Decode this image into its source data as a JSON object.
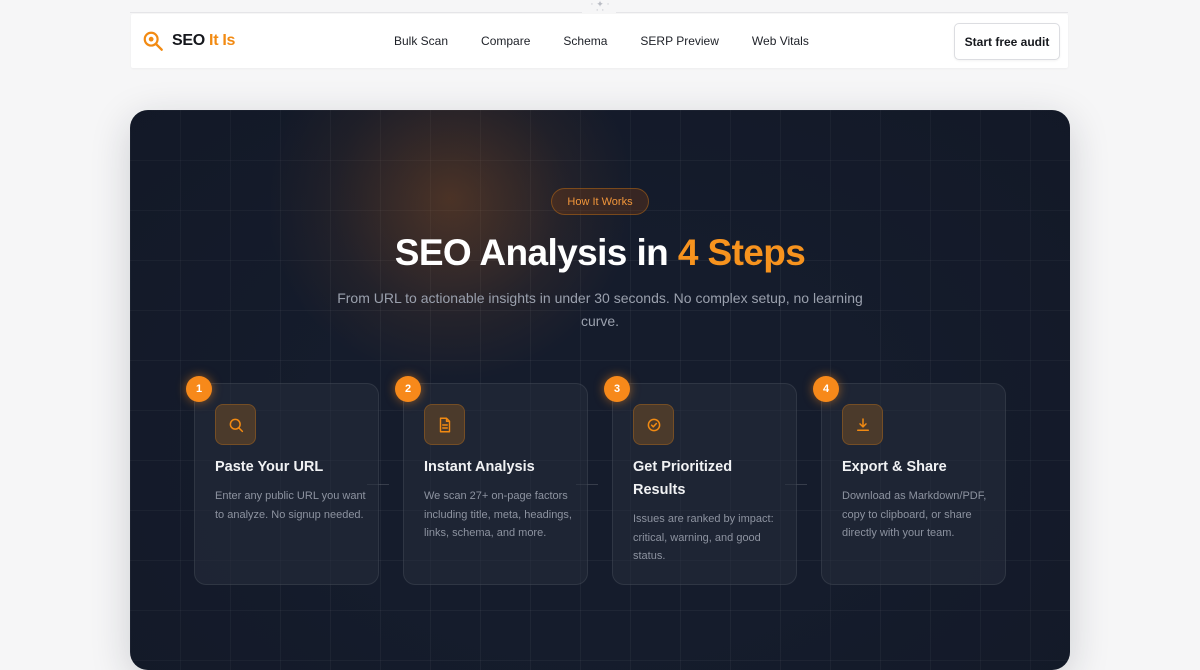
{
  "brand": {
    "name": "SEO",
    "accent": "It Is"
  },
  "nav": {
    "links": [
      "Bulk Scan",
      "Compare",
      "Schema",
      "SERP Preview",
      "Web Vitals"
    ],
    "cta": "Start free audit"
  },
  "hero": {
    "badge": "How It Works",
    "title_main": "SEO Analysis in ",
    "title_accent": "4 Steps",
    "subtitle": "From URL to actionable insights in under 30 seconds. No complex setup, no learning curve."
  },
  "steps": [
    {
      "number": "1",
      "icon": "search-icon",
      "title": "Paste Your URL",
      "description": "Enter any public URL you want to analyze. No signup needed."
    },
    {
      "number": "2",
      "icon": "document-icon",
      "title": "Instant Analysis",
      "description": "We scan 27+ on-page factors including title, meta, headings, links, schema, and more."
    },
    {
      "number": "3",
      "icon": "check-circle-icon",
      "title": "Get Prioritized Results",
      "description": "Issues are ranked by impact: critical, warning, and good status."
    },
    {
      "number": "4",
      "icon": "download-icon",
      "title": "Export & Share",
      "description": "Download as Markdown/PDF, copy to clipboard, or share directly with your team."
    }
  ],
  "colors": {
    "accent": "#f7931e",
    "hero_bg": "#151c2c",
    "page_bg": "#f6f6f7"
  }
}
